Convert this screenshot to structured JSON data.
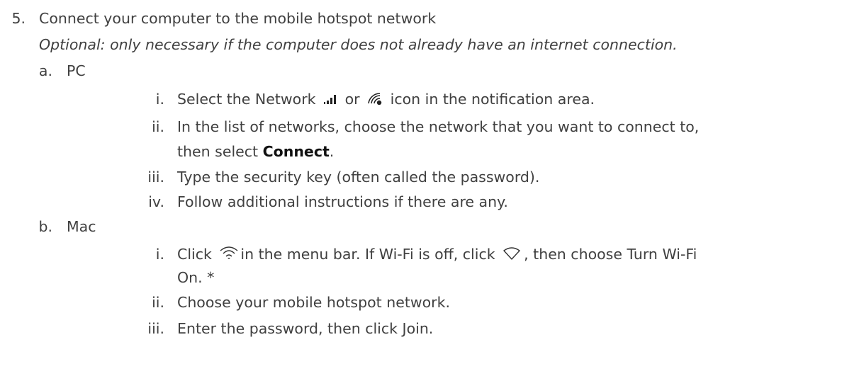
{
  "step5": {
    "num": "5.",
    "title": "Connect your computer to the mobile hotspot network",
    "note": "Optional: only necessary if the computer does not already have an internet connection."
  },
  "pc": {
    "letter": "a.",
    "label": "PC",
    "i": {
      "num": "i.",
      "pre": "Select the Network",
      "or": "or",
      "post": "icon in the notification area."
    },
    "ii": {
      "num": "ii.",
      "line1": "In the list of networks, choose the network that you want to connect to,",
      "pre": "then select",
      "bold": "Connect",
      "post": "."
    },
    "iii": {
      "num": "iii.",
      "text": "Type the security key (often called the password)."
    },
    "iv": {
      "num": "iv.",
      "text": "Follow additional instructions if there are any."
    }
  },
  "mac": {
    "letter": "b.",
    "label": "Mac",
    "i": {
      "num": "i.",
      "pre": "Click",
      "mid": "in the menu bar. If Wi-Fi is off, click",
      "post": ", then choose Turn Wi-Fi",
      "line2": "On. *"
    },
    "ii": {
      "num": "ii.",
      "text": "Choose your mobile hotspot network."
    },
    "iii": {
      "num": "iii.",
      "text": "Enter the password, then click Join."
    }
  },
  "icons": [
    "cellular-signal-icon",
    "wifi-windows-icon",
    "wifi-mac-icon",
    "wifi-off-icon"
  ]
}
